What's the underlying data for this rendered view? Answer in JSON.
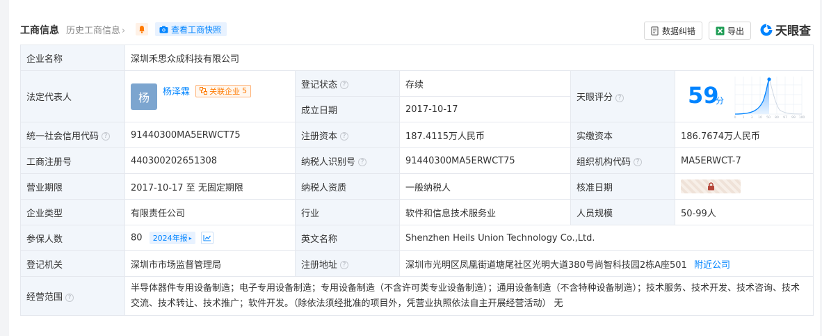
{
  "header": {
    "title": "工商信息",
    "history_label": "历史工商信息",
    "snapshot_label": "查看工商快照",
    "correct_label": "数据纠错",
    "export_label": "导出",
    "brand_name": "天眼查"
  },
  "company": {
    "name_label": "企业名称",
    "name": "深圳禾思众成科技有限公司",
    "legal_label": "法定代表人",
    "legal_avatar": "杨",
    "legal_name": "杨泽霖",
    "related_label": "关联企业",
    "related_count": "5",
    "reg_status_label": "登记状态",
    "reg_status": "存续",
    "est_date_label": "成立日期",
    "est_date": "2017-10-17",
    "score_label": "天眼评分",
    "score": "59",
    "score_unit": "分",
    "score_axis": [
      "0",
      "1",
      "3",
      "10",
      "50",
      "80",
      "97",
      "99",
      "100"
    ],
    "credit_code_label": "统一社会信用代码",
    "credit_code": "91440300MA5ERWCT75",
    "reg_capital_label": "注册资本",
    "reg_capital": "187.4115万人民币",
    "paid_capital_label": "实缴资本",
    "paid_capital": "186.7674万人民币",
    "reg_no_label": "工商注册号",
    "reg_no": "440300202651308",
    "tax_id_label": "纳税人识别号",
    "tax_id": "91440300MA5ERWCT75",
    "org_code_label": "组织机构代码",
    "org_code": "MA5ERWCT-7",
    "term_label": "营业期限",
    "term": "2017-10-17 至 无固定期限",
    "tax_qual_label": "纳税人资质",
    "tax_qual": "一般纳税人",
    "approve_date_label": "核准日期",
    "type_label": "企业类型",
    "type": "有限责任公司",
    "industry_label": "行业",
    "industry": "软件和信息技术服务业",
    "staff_label": "人员规模",
    "staff": "50-99人",
    "insured_label": "参保人数",
    "insured": "80",
    "insured_year": "2024年报",
    "en_name_label": "英文名称",
    "en_name": "Shenzhen Heils Union Technology Co.,Ltd.",
    "authority_label": "登记机关",
    "authority": "深圳市市场监督管理局",
    "address_label": "注册地址",
    "address": "深圳市光明区凤凰街道塘尾社区光明大道380号尚智科技园2栋A座501",
    "nearby_label": "附近公司",
    "scope_label": "经营范围",
    "scope": "半导体器件专用设备制造；电子专用设备制造；专用设备制造（不含许可类专业设备制造）；通用设备制造（不含特种设备制造）；技术服务、技术开发、技术咨询、技术交流、技术转让、技术推广；软件开发。（除依法须经批准的项目外，凭营业执照依法自主开展经营活动） 无"
  },
  "colors": {
    "accent": "#0084ff",
    "label_bg": "#f2f6fb",
    "status_green": "#00a068",
    "badge_orange": "#ff7a00"
  }
}
